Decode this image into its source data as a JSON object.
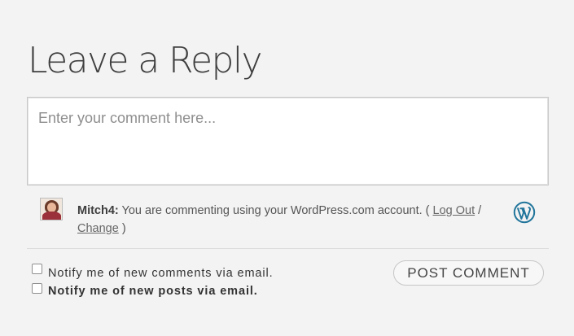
{
  "reply": {
    "title": "Leave a Reply",
    "comment_placeholder": "Enter your comment here...",
    "identity": {
      "username": "Mitch4:",
      "message": " You are commenting using your WordPress.com account. ( ",
      "logout_label": "Log Out",
      "separator": " /",
      "change_label": "Change",
      "close_paren": " )"
    },
    "options": {
      "notify_comments_label": "Notify me of new comments via email.",
      "notify_posts_label": "Notify me of new posts via email.",
      "notify_comments_checked": false,
      "notify_posts_checked": false
    },
    "submit_label": "POST COMMENT"
  },
  "icons": {
    "avatar": "user-avatar-photo",
    "wordpress": "wordpress-logo-icon"
  },
  "colors": {
    "background": "#f3f3f3",
    "wordpress_blue": "#21759b",
    "title": "#3f3f3f"
  }
}
